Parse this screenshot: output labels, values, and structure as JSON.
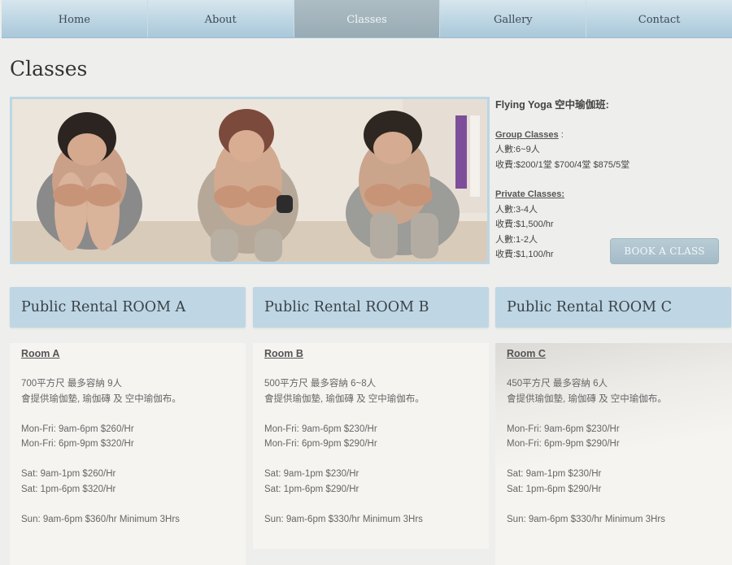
{
  "nav": {
    "items": [
      {
        "label": "Home"
      },
      {
        "label": "About"
      },
      {
        "label": "Classes"
      },
      {
        "label": "Gallery"
      },
      {
        "label": "Contact"
      }
    ],
    "active": "Classes"
  },
  "page": {
    "title": "Classes"
  },
  "hero": {
    "image": "three women in seated forward-bend yoga pose"
  },
  "info": {
    "heading": "Flying Yoga 空中瑜伽班:",
    "group_label": "Group Classes",
    "group_suffix": " :",
    "group_people": "人數:6~9人",
    "group_fee": "收費:$200/1堂 $700/4堂 $875/5堂",
    "private_label": "Private Classes:",
    "private_lines": [
      "人數:3-4人",
      "收費:$1,500/hr",
      "人數:1-2人",
      "收費:$1,100/hr"
    ],
    "book_button": "BOOK A CLASS"
  },
  "rooms": [
    {
      "title": "Public Rental ROOM A",
      "name": "Room A",
      "size": "700平方尺 最多容納 9人",
      "provided": "會提供瑜伽墊, 瑜伽磚 及 空中瑜伽布。",
      "weekday1": "Mon-Fri: 9am-6pm  $260/Hr",
      "weekday2": "Mon-Fri: 6pm-9pm  $320/Hr",
      "sat1": "Sat: 9am-1pm $260/Hr",
      "sat2": "Sat: 1pm-6pm $320/Hr",
      "sun": "Sun: 9am-6pm $360/hr Minimum 3Hrs"
    },
    {
      "title": "Public Rental ROOM B",
      "name": "Room B",
      "size": "500平方尺 最多容納 6~8人",
      "provided": "會提供瑜伽墊, 瑜伽磚 及 空中瑜伽布。",
      "weekday1": "Mon-Fri: 9am-6pm  $230/Hr",
      "weekday2": "Mon-Fri: 6pm-9pm  $290/Hr",
      "sat1": "Sat: 9am-1pm $230/Hr",
      "sat2": "Sat: 1pm-6pm $290/Hr",
      "sun": "Sun: 9am-6pm $330/hr Minimum 3Hrs"
    },
    {
      "title": "Public Rental ROOM C",
      "name": "Room C",
      "size": "450平方尺 最多容納 6人",
      "provided": "會提供瑜伽墊, 瑜伽磚 及 空中瑜伽布。",
      "weekday1": "Mon-Fri: 9am-6pm  $230/Hr",
      "weekday2": "Mon-Fri: 6pm-9pm  $290/Hr",
      "sat1": "Sat: 9am-1pm $230/Hr",
      "sat2": "Sat: 1pm-6pm $290/Hr",
      "sun": "Sun: 9am-6pm $330/hr Minimum 3Hrs"
    }
  ],
  "colors": {
    "nav_bg": "#bcd5e3",
    "nav_active": "#9eb1ba",
    "card_header": "#bfd7e4",
    "button": "#aec2cd"
  }
}
